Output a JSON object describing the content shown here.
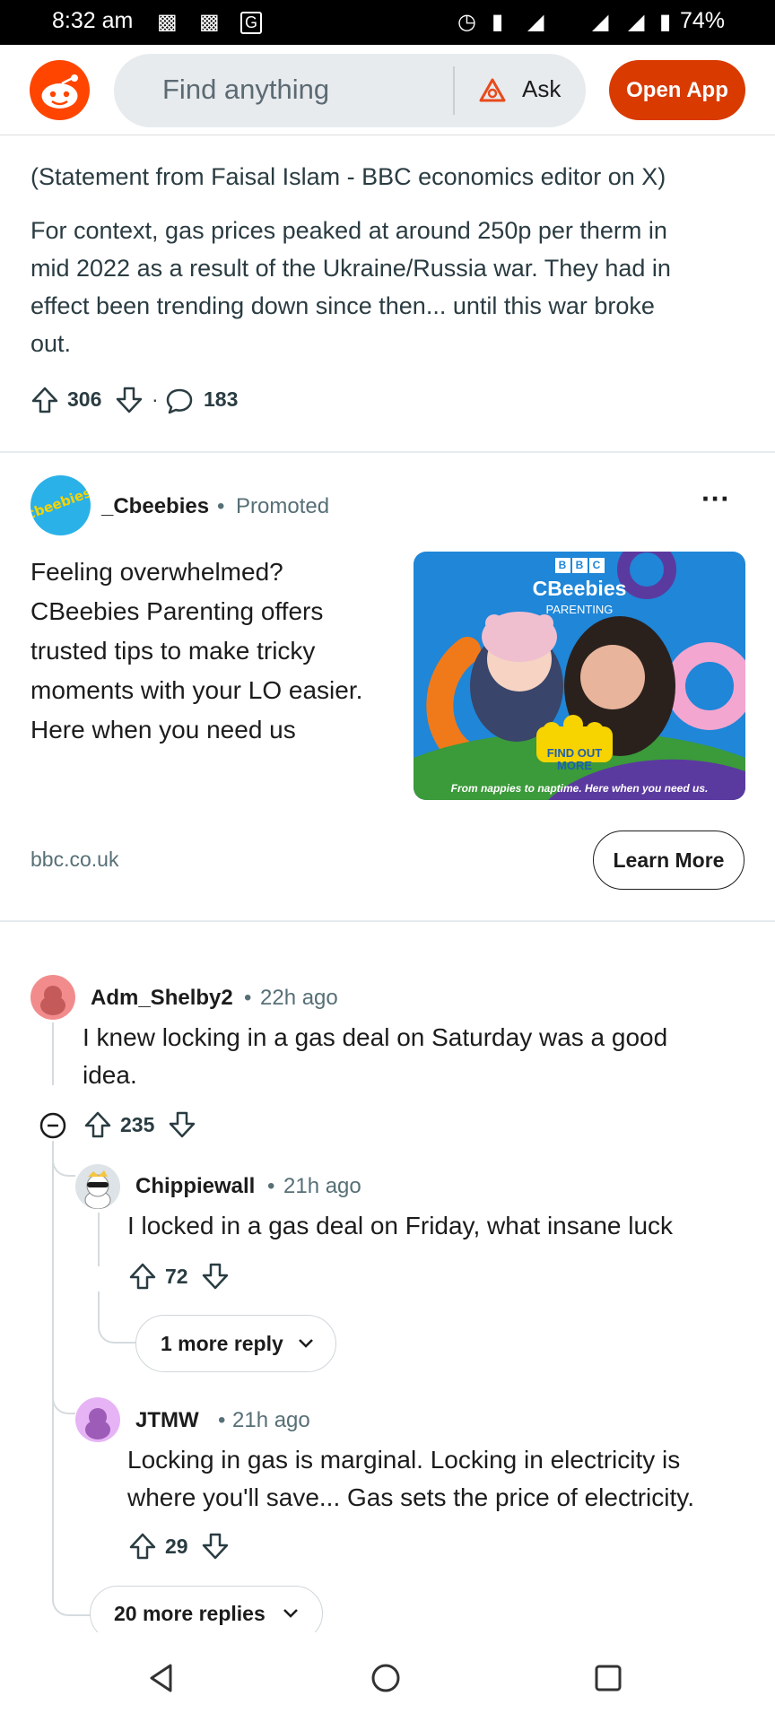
{
  "status_bar": {
    "time": "8:32 am",
    "battery": "74%"
  },
  "header": {
    "search_placeholder": "Find anything",
    "ask_label": "Ask",
    "open_app_label": "Open App"
  },
  "post": {
    "statement": "(Statement from Faisal Islam - BBC economics editor on X)",
    "context_lines": [
      "For context, gas prices peaked at around 250p per therm in",
      "mid 2022 as a result of the Ukraine/Russia war. They had in",
      "effect been trending down since then... until this war broke",
      "out."
    ],
    "upvotes": "306",
    "comments": "183"
  },
  "ad": {
    "advertiser": "_Cbeebies",
    "promoted_label": "Promoted",
    "body_lines": [
      "Feeling overwhelmed?",
      "CBeebies Parenting offers",
      "trusted tips to make tricky",
      "moments with your LO easier.",
      "Here when you need us"
    ],
    "image": {
      "brand": "BBC",
      "title": "CBeebies",
      "subtitle": "PARENTING",
      "cta": "FIND OUT MORE",
      "tagline": "From nappies to naptime. Here when you need us."
    },
    "domain": "bbc.co.uk",
    "learn_more_label": "Learn More"
  },
  "comments": [
    {
      "author": "Adm_Shelby2",
      "time": "22h ago",
      "lines": [
        "I knew locking in a gas deal on Saturday was a good",
        "idea."
      ],
      "votes": "235"
    },
    {
      "author": "Chippiewall",
      "time": "21h ago",
      "lines": [
        "I locked in a gas deal on Friday, what insane luck"
      ],
      "votes": "72",
      "more_replies": "1 more reply"
    },
    {
      "author": "JTMW",
      "time": "21h ago",
      "lines": [
        "Locking in gas is marginal. Locking in electricity is",
        "where you'll save... Gas sets the price of electricity."
      ],
      "votes": "29"
    }
  ],
  "more_replies": "20 more replies",
  "colors": {
    "reddit_orange": "#ff4500",
    "open_app_bg": "#d93a00",
    "search_bg": "#e7ebee",
    "ad_bg": "#1f86d8"
  }
}
